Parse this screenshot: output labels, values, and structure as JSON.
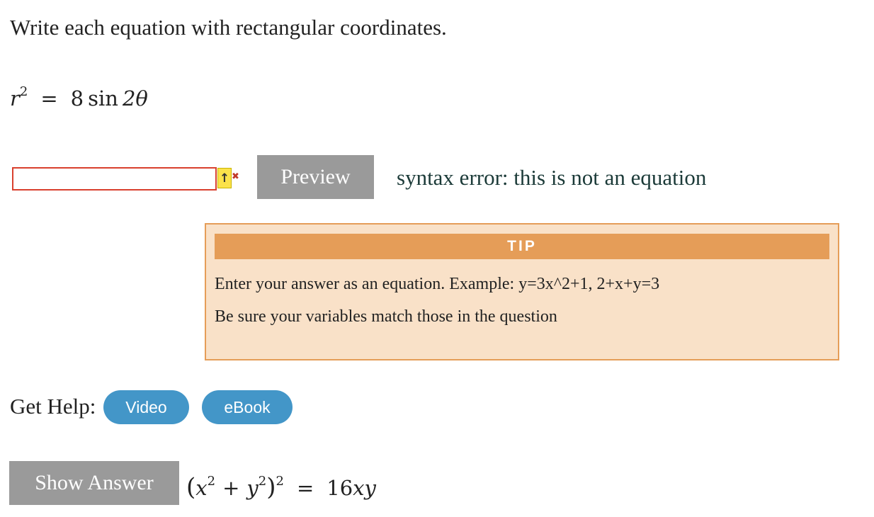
{
  "question": {
    "prompt": "Write each equation with rectangular coordinates.",
    "equation": {
      "lhs_var": "r",
      "lhs_exp": "2",
      "equals": "=",
      "coefficient": "8",
      "func": "sin",
      "arg": "2θ"
    }
  },
  "answer_input": {
    "value": "",
    "placeholder": ""
  },
  "icons": {
    "arrow": "↑",
    "error_marker": "✖",
    "arrow_name": "up-arrow-icon",
    "error_marker_name": "error-marker-icon"
  },
  "preview_button": {
    "label": "Preview"
  },
  "error_message": "syntax error: this is not an equation",
  "tip": {
    "title": "TIP",
    "line1": "Enter your answer as an equation. Example: y=3x^2+1, 2+x+y=3",
    "line2": "Be sure your variables match those in the question"
  },
  "help": {
    "label": "Get Help:",
    "buttons": [
      "Video",
      "eBook"
    ]
  },
  "show_answer": {
    "label": "Show Answer",
    "answer": {
      "open_paren": "(",
      "x": "x",
      "x_exp": "2",
      "plus": "+",
      "y": "y",
      "y_exp": "2",
      "close_paren": ")",
      "outer_exp": "2",
      "equals": "=",
      "rhs_coef": "16",
      "rhs_vars": "xy"
    }
  },
  "colors": {
    "input_error_border": "#d9402e",
    "button_gray": "#9a9a9a",
    "tip_header": "#e59d58",
    "tip_background": "#f9e1c8",
    "help_button": "#4396c8",
    "error_text": "#1b3a38"
  }
}
